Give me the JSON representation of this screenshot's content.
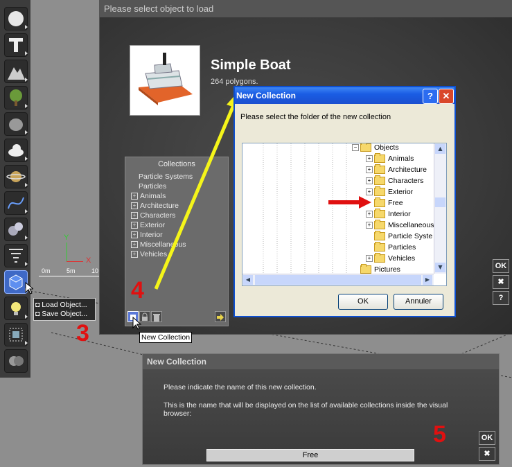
{
  "load_dialog": {
    "title": "Please select object to load",
    "object_name": "Simple Boat",
    "object_polygons": "264 polygons.",
    "collections_header": "Collections",
    "collections": [
      {
        "label": "Particle Systems",
        "expandable": false
      },
      {
        "label": "Particles",
        "expandable": false
      },
      {
        "label": "Animals",
        "expandable": true
      },
      {
        "label": "Architecture",
        "expandable": true
      },
      {
        "label": "Characters",
        "expandable": true
      },
      {
        "label": "Exterior",
        "expandable": true
      },
      {
        "label": "Interior",
        "expandable": true
      },
      {
        "label": "Miscellaneous",
        "expandable": true
      },
      {
        "label": "Vehicles",
        "expandable": true
      }
    ],
    "side_buttons": {
      "ok": "OK",
      "cancel": "✖",
      "help": "?"
    }
  },
  "toolbar_menu": {
    "items": [
      "Load Object...",
      "Save Object..."
    ]
  },
  "tooltip": "New Collection",
  "viewport": {
    "axis_y": "Y",
    "axis_x": "X",
    "scale_labels": [
      "0m",
      "5m",
      "10"
    ]
  },
  "xp_dialog": {
    "title": "New Collection",
    "help_btn": "?",
    "close_btn": "✕",
    "message": "Please select the folder of the new collection",
    "tree": [
      {
        "label": "Objects",
        "toggle": "−",
        "indent": 0
      },
      {
        "label": "Animals",
        "toggle": "+",
        "indent": 1
      },
      {
        "label": "Architecture",
        "toggle": "+",
        "indent": 1
      },
      {
        "label": "Characters",
        "toggle": "+",
        "indent": 1
      },
      {
        "label": "Exterior",
        "toggle": "+",
        "indent": 1
      },
      {
        "label": "Free",
        "toggle": "",
        "indent": 1
      },
      {
        "label": "Interior",
        "toggle": "+",
        "indent": 1
      },
      {
        "label": "Miscellaneous",
        "toggle": "+",
        "indent": 1
      },
      {
        "label": "Particle Syste",
        "toggle": "",
        "indent": 1
      },
      {
        "label": "Particles",
        "toggle": "",
        "indent": 1
      },
      {
        "label": "Vehicles",
        "toggle": "+",
        "indent": 1
      },
      {
        "label": "Pictures",
        "toggle": "",
        "indent": 0
      }
    ],
    "ok_label": "OK",
    "cancel_label": "Annuler"
  },
  "name_dialog": {
    "title": "New Collection",
    "line1": "Please indicate the name of this new collection.",
    "line2": "This is the name that will be displayed on the list of available collections inside the visual browser:",
    "input_value": "Free",
    "ok": "OK",
    "cancel": "✖"
  },
  "steps": [
    "3",
    "4",
    "5"
  ],
  "colors": {
    "annotation_red": "#e01010",
    "annotation_yellow": "#f5f51a",
    "xp_blue": "#1a5de4"
  }
}
